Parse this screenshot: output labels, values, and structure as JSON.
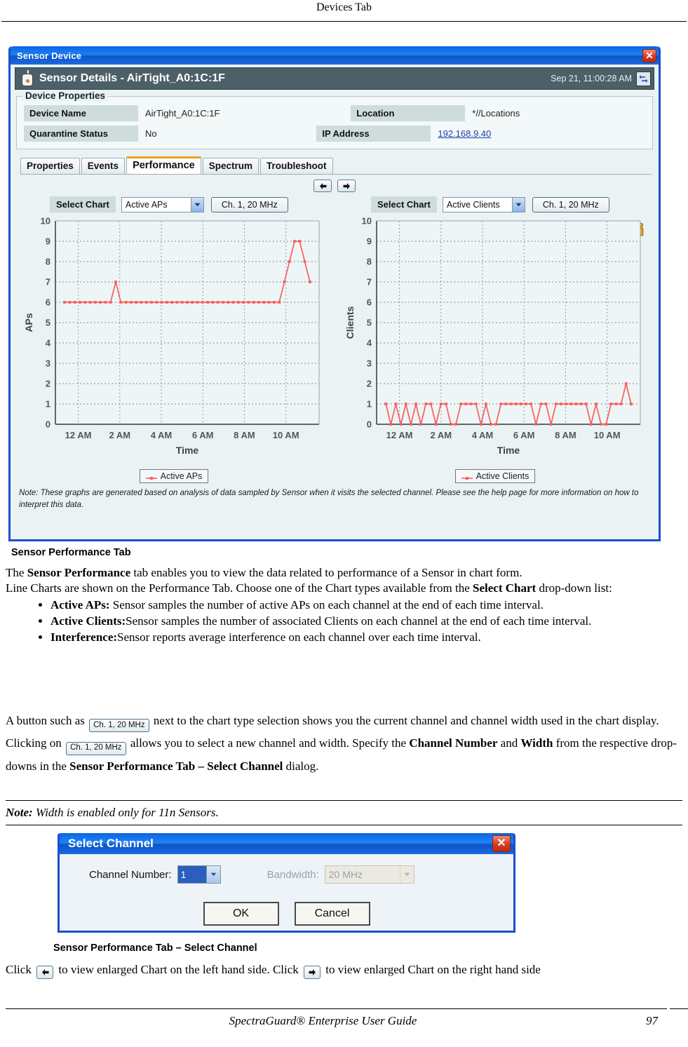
{
  "page": {
    "running_head": "Devices Tab",
    "footer_text": "SpectraGuard® Enterprise User Guide",
    "page_number": "97"
  },
  "window": {
    "title": "Sensor Device",
    "close_label": "✕",
    "detail_title": "Sensor Details -  AirTight_A0:1C:1F",
    "timestamp": "Sep 21, 11:00:28 AM"
  },
  "device_properties": {
    "legend": "Device Properties",
    "rows": [
      {
        "label": "Device Name",
        "value": "AirTight_A0:1C:1F",
        "label2": "Location",
        "value2": "*//Locations"
      },
      {
        "label": "Quarantine Status",
        "value": "No",
        "label2": "IP Address",
        "value2": "192.168.9.40"
      }
    ]
  },
  "tabs": [
    {
      "label": "Properties",
      "active": false
    },
    {
      "label": "Events",
      "active": false
    },
    {
      "label": "Performance",
      "active": true
    },
    {
      "label": "Spectrum",
      "active": false
    },
    {
      "label": "Troubleshoot",
      "active": false
    }
  ],
  "nav": {
    "prev": "←",
    "next": "→"
  },
  "left_panel": {
    "select_chart_label": "Select Chart",
    "selected_chart": "Active APs",
    "channel_button": "Ch. 1, 20 MHz",
    "legend_label": "Active APs"
  },
  "right_panel": {
    "select_chart_label": "Select Chart",
    "selected_chart": "Active Clients",
    "channel_button": "Ch. 1, 20 MHz",
    "legend_label": "Active Clients"
  },
  "note_text": "Note: These graphs are generated based on analysis of data sampled by Sensor when it visits the selected channel. Please see the help page for more information on how to interpret this data.",
  "captions": {
    "figure1": "Sensor Performance Tab",
    "figure2": "Sensor Performance Tab – Select Channel"
  },
  "prose": {
    "p1_a": "The ",
    "p1_b": "Sensor Performance",
    "p1_c": " tab enables you to view the data related to performance of a Sensor in chart form.",
    "p2_a": "Line Charts are shown on the Performance Tab. Choose one of the Chart types available from the ",
    "p2_b": "Select Chart",
    "p2_c": " drop-down list:",
    "bullet1_b": "Active APs:",
    "bullet1_t": " Sensor samples the number of active APs on each channel at the end of each time interval.",
    "bullet2_b": "Active Clients:",
    "bullet2_t": "Sensor samples the number of associated Clients on each channel at the end of each time interval.",
    "bullet3_b": "Interference:",
    "bullet3_t": "Sensor reports average interference on each channel over each time interval.",
    "p3_a": " A button such as ",
    "p3_btn": "Ch. 1, 20 MHz",
    "p3_b": " next to the chart type selection shows you the current channel and channel width used in the chart display. Clicking on ",
    "p3_btn2": "Ch. 1, 20 MHz",
    "p3_c": " allows you to select a new channel and width. Specify the ",
    "p3_bold1": "Channel Number",
    "p3_d": " and ",
    "p3_bold2": "Width",
    "p3_e": " from the respective drop-downs in the ",
    "p3_bold3": "Sensor Performance Tab – Select Channel",
    "p3_f": " dialog.",
    "note_b": "Note:",
    "note_t": " Width is enabled only for 11n Sensors.",
    "p4_a": "Click ",
    "p4_b": " to view enlarged Chart on the left hand side. Click ",
    "p4_c": " to view enlarged Chart on the right hand side"
  },
  "dialog": {
    "title": "Select Channel",
    "close_label": "✕",
    "channel_number_label": "Channel Number:",
    "channel_number_value": "1",
    "bandwidth_label": "Bandwidth:",
    "bandwidth_value": "20 MHz",
    "ok": "OK",
    "cancel": "Cancel"
  },
  "colors": {
    "series": "#f9605f",
    "title_blue": "#1a4fd0",
    "header_gray": "#4c6068",
    "panel_bg": "#eaf2f4",
    "label_bg": "#cfdcdd",
    "tab_accent": "#f0a21a",
    "link": "#1a3fa8"
  },
  "chart_data": [
    {
      "type": "line",
      "title": "Active APs",
      "xlabel": "Time",
      "ylabel": "APs",
      "ylim": [
        0,
        10
      ],
      "yticks": [
        0,
        1,
        2,
        3,
        4,
        5,
        6,
        7,
        8,
        9,
        10
      ],
      "xticks": [
        "12 AM",
        "2 AM",
        "4 AM",
        "6 AM",
        "8 AM",
        "10 AM"
      ],
      "grid": true,
      "legend": "Active APs",
      "legend_position": "below",
      "series": [
        {
          "name": "Active APs",
          "color": "#f9605f",
          "values": [
            6,
            6,
            6,
            6,
            6,
            6,
            6,
            6,
            6,
            6,
            7,
            6,
            6,
            6,
            6,
            6,
            6,
            6,
            6,
            6,
            6,
            6,
            6,
            6,
            6,
            6,
            6,
            6,
            6,
            6,
            6,
            6,
            6,
            6,
            6,
            6,
            6,
            6,
            6,
            6,
            6,
            6,
            6,
            7,
            8,
            9,
            9,
            8,
            7
          ]
        }
      ]
    },
    {
      "type": "line",
      "title": "Active Clients",
      "xlabel": "Time",
      "ylabel": "Clients",
      "ylim": [
        0,
        10
      ],
      "yticks": [
        0,
        1,
        2,
        3,
        4,
        5,
        6,
        7,
        8,
        9,
        10
      ],
      "xticks": [
        "12 AM",
        "2 AM",
        "4 AM",
        "6 AM",
        "8 AM",
        "10 AM"
      ],
      "grid": true,
      "legend": "Active Clients",
      "legend_position": "below",
      "series": [
        {
          "name": "Active Clients",
          "color": "#f9605f",
          "values": [
            1,
            0,
            1,
            0,
            1,
            0,
            1,
            0,
            1,
            1,
            0,
            1,
            1,
            0,
            0,
            1,
            1,
            1,
            1,
            0,
            1,
            0,
            0,
            1,
            1,
            1,
            1,
            1,
            1,
            1,
            0,
            1,
            1,
            0,
            1,
            1,
            1,
            1,
            1,
            1,
            1,
            0,
            1,
            0,
            0,
            1,
            1,
            1,
            2,
            1
          ]
        }
      ]
    }
  ]
}
